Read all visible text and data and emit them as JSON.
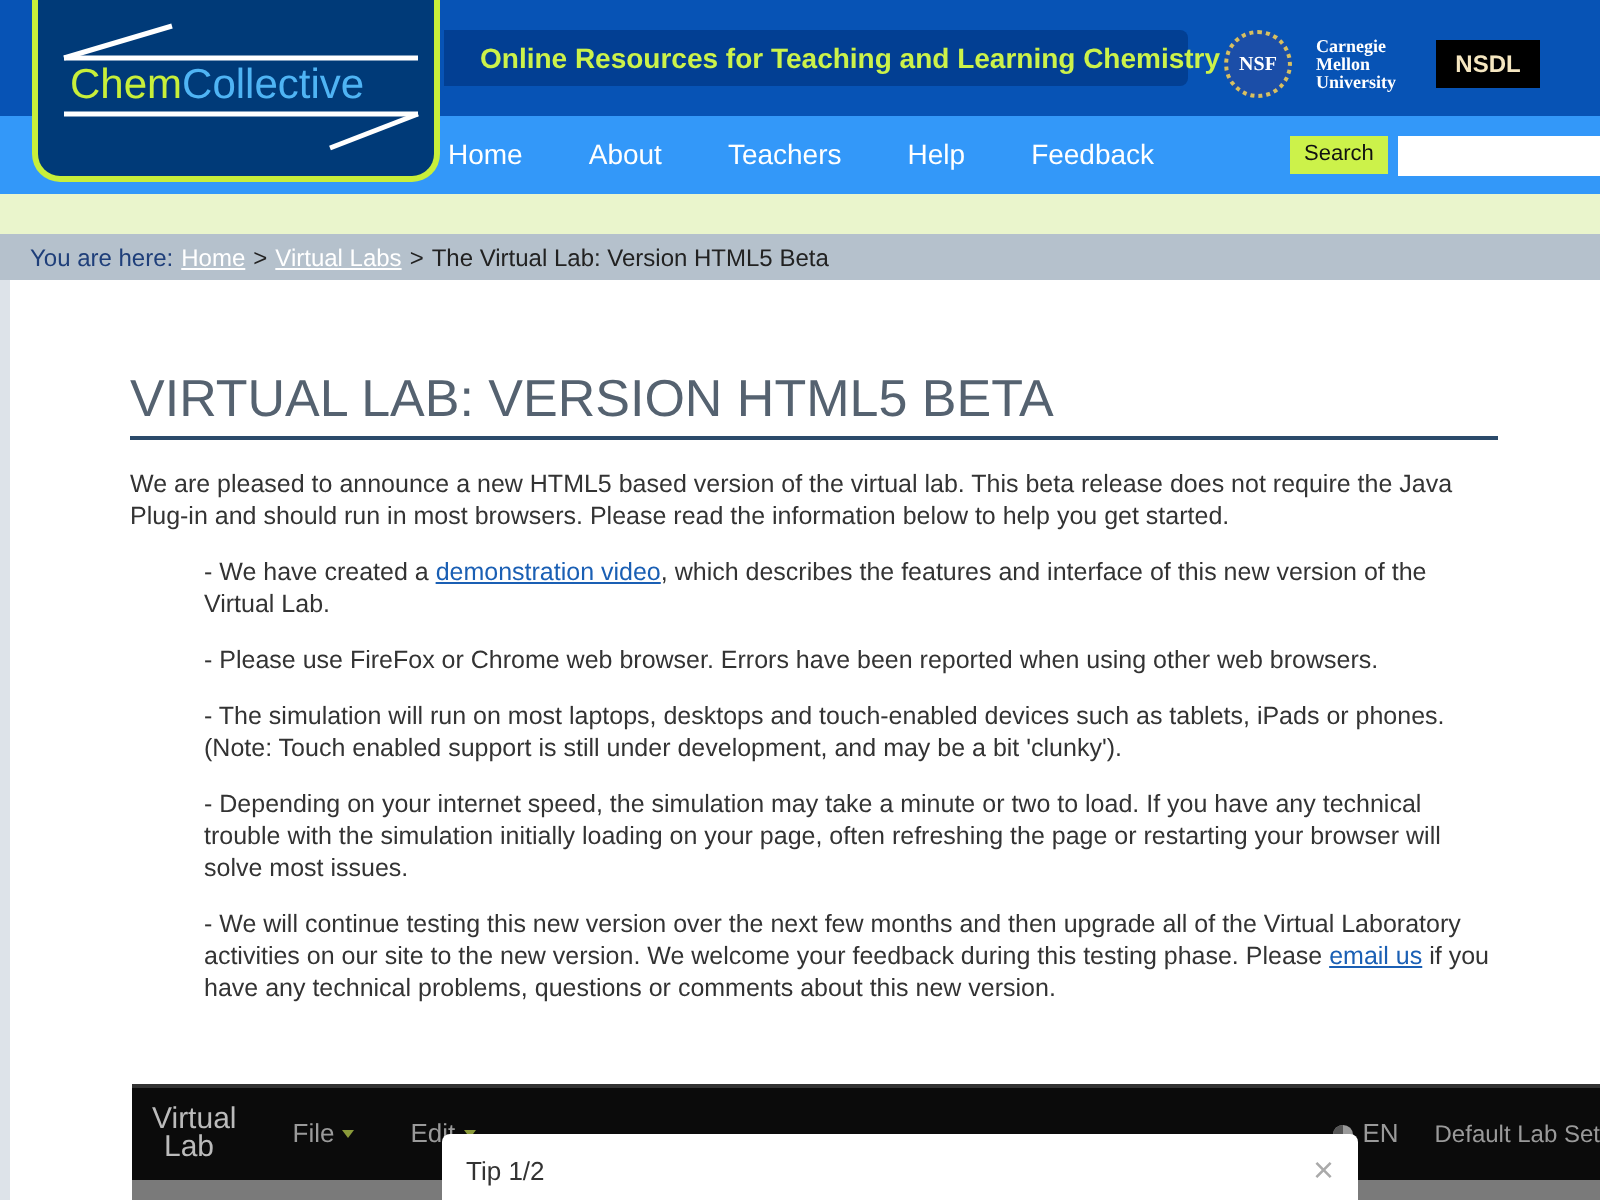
{
  "logo": {
    "part1": "Chem",
    "part2": "Collective"
  },
  "tagline": "Online Resources for Teaching and Learning Chemistry",
  "partner_logos": {
    "nsf": "NSF",
    "cmu": [
      "Carnegie",
      "Mellon",
      "University"
    ],
    "nsdl": "NSDL"
  },
  "nav": [
    {
      "label": "Home"
    },
    {
      "label": "About"
    },
    {
      "label": "Teachers"
    },
    {
      "label": "Help"
    },
    {
      "label": "Feedback"
    }
  ],
  "search": {
    "button": "Search"
  },
  "breadcrumb": {
    "prefix": "You are here:",
    "links": [
      "Home",
      "Virtual Labs"
    ],
    "separator": ">",
    "current": "The Virtual Lab: Version HTML5 Beta"
  },
  "heading": "VIRTUAL LAB: VERSION HTML5 BETA",
  "intro": "We are pleased to announce a new HTML5 based version of the virtual lab. This beta release does not require the Java Plug-in and should run in most browsers. Please read the information below to help you get started.",
  "items": [
    {
      "before": "- We have created a ",
      "link": "demonstration video",
      "after": ", which describes the features and interface of this new version of the Virtual Lab."
    },
    {
      "before": "- Please use FireFox or Chrome web browser. Errors have been reported when using other web browsers."
    },
    {
      "before": "- The simulation will run on most laptops, desktops and touch-enabled devices such as tablets, iPads or phones. (Note: Touch enabled support is still under development, and may be a bit 'clunky')."
    },
    {
      "before": "- Depending on your internet speed, the simulation may take a minute or two to load. If you have any technical trouble with the simulation initially loading on your page, often refreshing the page or restarting your browser will solve most issues."
    },
    {
      "before": "- We will continue testing this new version over the next few months and then upgrade all of the Virtual Laboratory activities on our site to the new version. We welcome your feedback during this testing phase. Please ",
      "link": "email us",
      "after": " if you have any technical problems, questions or comments about this new version."
    }
  ],
  "app": {
    "brand": [
      "Virtual",
      "Lab"
    ],
    "menus": [
      "File",
      "Edit"
    ],
    "language": "EN",
    "lab_set": "Default Lab Set",
    "tip": {
      "title": "Tip 1/2",
      "close": "×"
    }
  }
}
